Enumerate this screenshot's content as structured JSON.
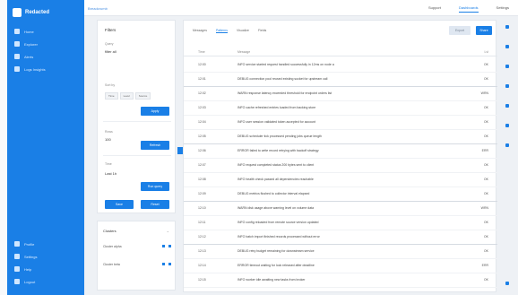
{
  "app": {
    "title": "Redacted"
  },
  "nav": {
    "items": [
      {
        "label": "Home",
        "icon": "home-icon"
      },
      {
        "label": "Explorer",
        "icon": "compass-icon"
      },
      {
        "label": "Alerts",
        "icon": "bell-icon"
      },
      {
        "label": "Logs Insights",
        "icon": "list-icon"
      }
    ],
    "bottom": [
      {
        "label": "Profile",
        "icon": "user-icon"
      },
      {
        "label": "Settings",
        "icon": "gear-icon"
      },
      {
        "label": "Help",
        "icon": "help-icon"
      },
      {
        "label": "Logout",
        "icon": "logout-icon"
      }
    ]
  },
  "top": {
    "breadcrumb": "Breadcrumb",
    "links": [
      "Support",
      "Dashboards",
      "Settings"
    ]
  },
  "filters": {
    "title": "Filters",
    "field1_label": "Query",
    "field1_value": "filter all",
    "field2_label": "Sort by",
    "chips": [
      "Time",
      "Level",
      "Source"
    ],
    "apply_label": "Apply",
    "field3_label": "Rows",
    "field3_value": "100",
    "refresh_label": "Refresh",
    "field4_label": "Time",
    "field4_value": "Last 1h",
    "run_label": "Run query",
    "save_label": "Save",
    "reset_label": "Reset"
  },
  "clusters": {
    "title": "Clusters",
    "rows": [
      "Cluster alpha",
      "Cluster beta"
    ]
  },
  "main": {
    "tabs": [
      "Messages",
      "Patterns",
      "Visualize",
      "Fields"
    ],
    "header": {
      "time": "Time",
      "message": "Message",
      "level": "Lvl"
    },
    "export_label": "Export",
    "share_label": "Share",
    "rows": [
      {
        "time": "12:00",
        "message": "INFO service started request handled successfully in 12ms on node a",
        "level": "OK"
      },
      {
        "time": "12:01",
        "message": "DEBUG connection pool reused existing socket for upstream call",
        "level": "OK"
      },
      {
        "time": "12:02",
        "message": "WARN response latency exceeded threshold for endpoint orders list",
        "level": "WRN"
      },
      {
        "time": "12:03",
        "message": "INFO cache refreshed entries loaded from backing store",
        "level": "OK"
      },
      {
        "time": "12:04",
        "message": "INFO user session validated token accepted for account",
        "level": "OK"
      },
      {
        "time": "12:05",
        "message": "DEBUG scheduler tick processed pending jobs queue length",
        "level": "OK"
      },
      {
        "time": "12:06",
        "message": "ERROR failed to write record retrying with backoff strategy",
        "level": "ERR"
      },
      {
        "time": "12:07",
        "message": "INFO request completed status 200 bytes sent to client",
        "level": "OK"
      },
      {
        "time": "12:08",
        "message": "INFO health check passed all dependencies reachable",
        "level": "OK"
      },
      {
        "time": "12:09",
        "message": "DEBUG metrics flushed to collector interval elapsed",
        "level": "OK"
      },
      {
        "time": "12:10",
        "message": "WARN disk usage above warning level on volume data",
        "level": "WRN"
      },
      {
        "time": "12:11",
        "message": "INFO config reloaded from remote source version updated",
        "level": "OK"
      },
      {
        "time": "12:12",
        "message": "INFO batch import finished records processed without error",
        "level": "OK"
      },
      {
        "time": "12:13",
        "message": "DEBUG retry budget remaining for downstream service",
        "level": "OK"
      },
      {
        "time": "12:14",
        "message": "ERROR timeout waiting for lock released after deadline",
        "level": "ERR"
      },
      {
        "time": "12:15",
        "message": "INFO worker idle awaiting new tasks from broker",
        "level": "OK"
      }
    ]
  }
}
